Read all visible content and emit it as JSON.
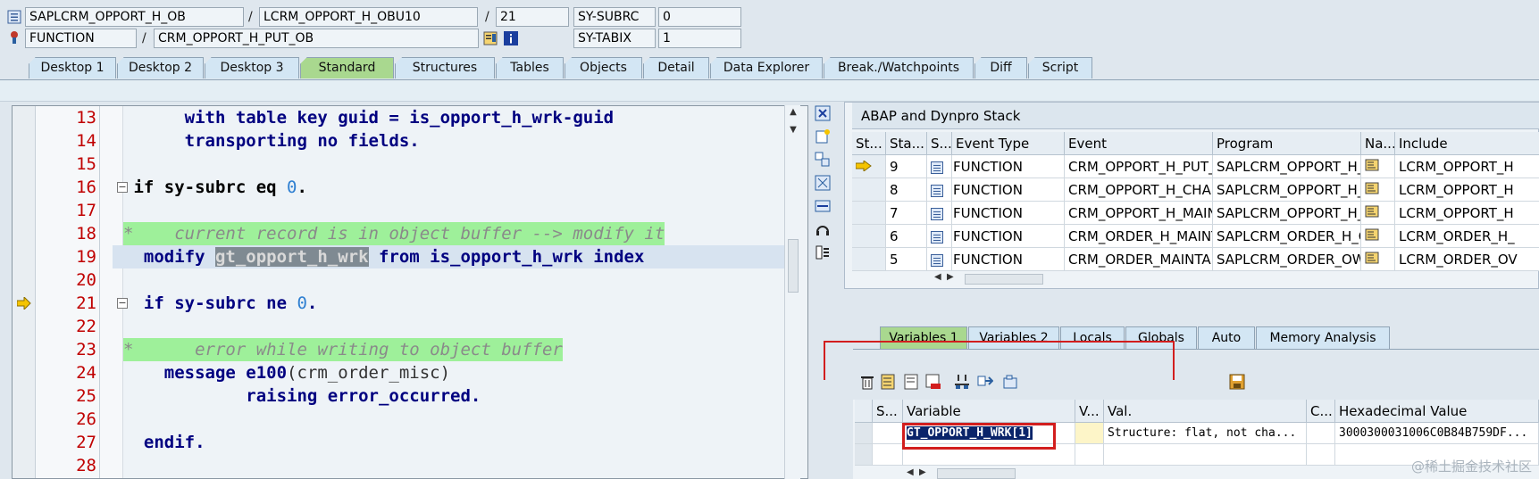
{
  "header": {
    "program": "SAPLCRM_OPPORT_H_OB",
    "include": "LCRM_OPPORT_H_OBU10",
    "line": "21",
    "subrc_label": "SY-SUBRC",
    "subrc_value": "0",
    "event_type": "FUNCTION",
    "event": "CRM_OPPORT_H_PUT_OB",
    "tabix_label": "SY-TABIX",
    "tabix_value": "1"
  },
  "tabs": [
    "Desktop 1",
    "Desktop 2",
    "Desktop 3",
    "Standard",
    "Structures",
    "Tables",
    "Objects",
    "Detail",
    "Data Explorer",
    "Break./Watchpoints",
    "Diff",
    "Script"
  ],
  "active_tab": "Standard",
  "code_lines": [
    {
      "no": "13",
      "text": "      with table key guid = is_opport_h_wrk-guid"
    },
    {
      "no": "14",
      "text": "      transporting no fields."
    },
    {
      "no": "15",
      "text": ""
    },
    {
      "no": "16",
      "text": " if sy-subrc eq ",
      "num": "0",
      "tail": "."
    },
    {
      "no": "17",
      "text": ""
    },
    {
      "no": "18",
      "comment": "*    current record is in object buffer --> modify it"
    },
    {
      "no": "19",
      "pre": "  modify ",
      "hl": "gt_opport_h_wrk",
      "post": " from is_opport_h_wrk index"
    },
    {
      "no": "20",
      "text": ""
    },
    {
      "no": "21",
      "text": "  if sy-subrc ne ",
      "num": "0",
      "tail": "."
    },
    {
      "no": "22",
      "text": ""
    },
    {
      "no": "23",
      "comment": "*      error while writing to object buffer"
    },
    {
      "no": "24",
      "pre": "    message e100",
      "paren": "(crm_order_misc)",
      "post": ""
    },
    {
      "no": "25",
      "text": "            raising error_occurred."
    },
    {
      "no": "26",
      "text": ""
    },
    {
      "no": "27",
      "text": "  endif."
    },
    {
      "no": "28",
      "text": ""
    }
  ],
  "stack": {
    "title": "ABAP and Dynpro Stack",
    "columns": [
      "St...",
      "Sta...",
      "S...",
      "Event Type",
      "Event",
      "Program",
      "Na...",
      "Include"
    ],
    "rows": [
      {
        "level": "9",
        "type": "FUNCTION",
        "event": "CRM_OPPORT_H_PUT_O...",
        "program": "SAPLCRM_OPPORT_H_OB",
        "include": "LCRM_OPPORT_H"
      },
      {
        "level": "8",
        "type": "FUNCTION",
        "event": "CRM_OPPORT_H_CHANG...",
        "program": "SAPLCRM_OPPORT_H_O...",
        "include": "LCRM_OPPORT_H"
      },
      {
        "level": "7",
        "type": "FUNCTION",
        "event": "CRM_OPPORT_H_MAINT...",
        "program": "SAPLCRM_OPPORT_H_O...",
        "include": "LCRM_OPPORT_H"
      },
      {
        "level": "6",
        "type": "FUNCTION",
        "event": "CRM_ORDER_H_MAINTA...",
        "program": "SAPLCRM_ORDER_H_OW",
        "include": "LCRM_ORDER_H_"
      },
      {
        "level": "5",
        "type": "FUNCTION",
        "event": "CRM_ORDER_MAINTAIN...",
        "program": "SAPLCRM_ORDER_OW",
        "include": "LCRM_ORDER_OV"
      }
    ]
  },
  "var_tabs": [
    "Variables 1",
    "Variables 2",
    "Locals",
    "Globals",
    "Auto",
    "Memory Analysis"
  ],
  "active_var_tab": "Variables 1",
  "variables": {
    "columns": [
      "S...",
      "Variable",
      "V...",
      "Val.",
      "C...",
      "Hexadecimal Value"
    ],
    "rows": [
      {
        "variable": "GT_OPPORT_H_WRK[1]",
        "value": "Structure: flat, not cha...",
        "hex": "3000300031006C0B84B759DF..."
      }
    ]
  },
  "watermark": "@稀土掘金技术社区",
  "colors": {
    "active_tab": "#a9d88f",
    "comment_bg": "#9ef09a",
    "highlight_red": "#d21e1e",
    "line_no": "#c00000"
  }
}
